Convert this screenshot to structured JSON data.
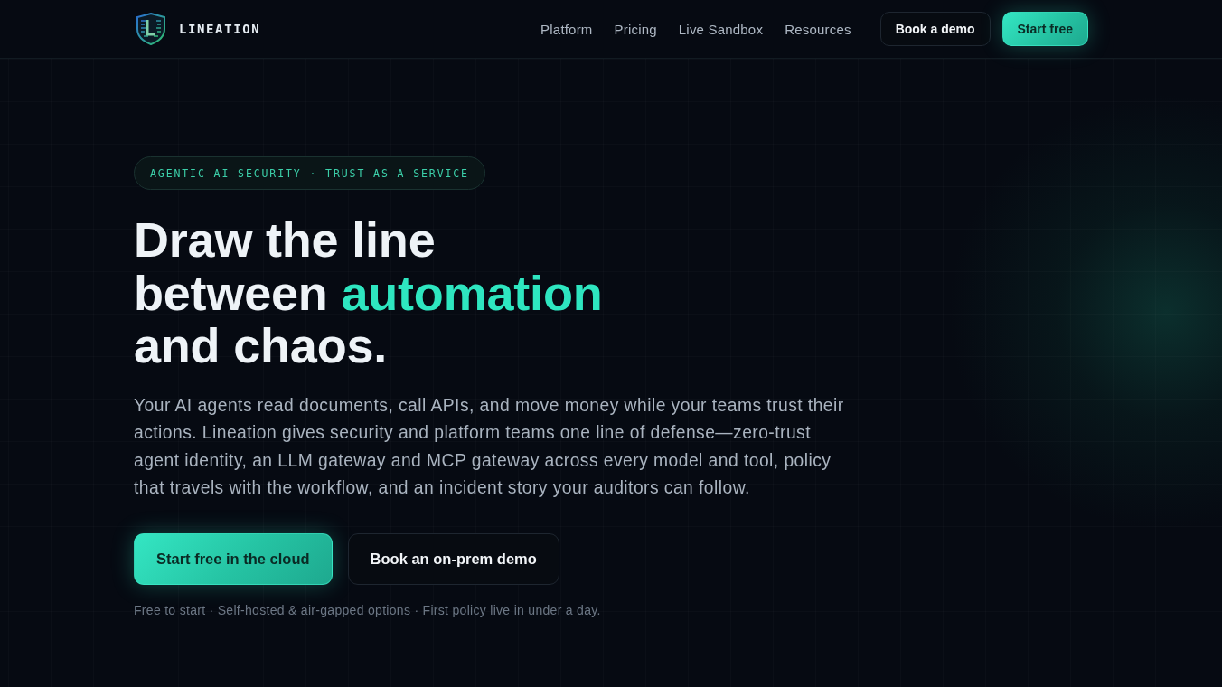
{
  "nav": {
    "brand": "LINEATION",
    "links": [
      {
        "label": "Platform"
      },
      {
        "label": "Pricing"
      },
      {
        "label": "Live Sandbox"
      },
      {
        "label": "Resources"
      }
    ],
    "buttons": [
      {
        "label": "Book a demo",
        "kind": "secondary"
      },
      {
        "label": "Start free",
        "kind": "primary"
      }
    ]
  },
  "hero": {
    "badge": "AGENTIC AI SECURITY · TRUST AS A SERVICE",
    "title_lines": [
      [
        {
          "text": "Draw the line",
          "highlight": false
        }
      ],
      [
        {
          "text": "between",
          "highlight": false
        },
        {
          "text": "automation",
          "highlight": true
        }
      ],
      [
        {
          "text": "and chaos.",
          "highlight": false
        }
      ]
    ],
    "description_lines": [
      "Your AI agents read documents, call APIs, and move money while your teams trust their",
      "actions. Lineation gives security and platform teams one line of defense—zero-trust",
      "agent identity, an LLM gateway and MCP gateway across every model and tool, policy",
      "that travels with the workflow, and an incident story your auditors can follow."
    ],
    "actions": [
      {
        "label": "Start free in the cloud",
        "kind": "primary"
      },
      {
        "label": "Book an on-prem demo",
        "kind": "secondary"
      }
    ],
    "note": "Free to start · Self-hosted & air-gapped options · First policy live in under a day."
  }
}
